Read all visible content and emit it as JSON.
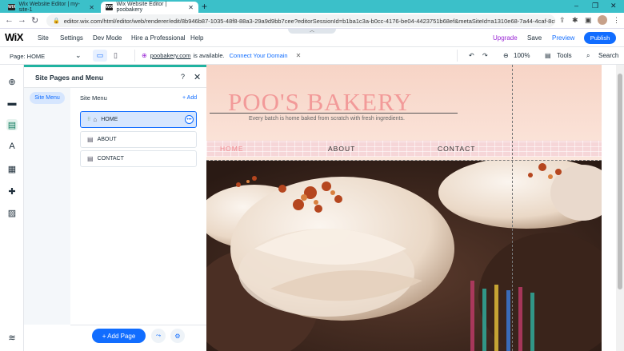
{
  "browser": {
    "tabs": [
      {
        "badge": "WIX",
        "title": "Wix Website Editor | my-site-1"
      },
      {
        "badge": "WIX",
        "title": "Wix Website Editor | poobakery"
      }
    ],
    "new_tab": "+",
    "url": "editor.wix.com/html/editor/web/renderer/edit/8b946b87-1035-48f8-88a3-29a9d9bb7cee?editorSessionId=b1ba1c3a-b0cc-4176-be04-4423751b68ef&metaSiteId=a1310e68-7a44-4caf-8c89...",
    "window_controls": [
      "–",
      "❐",
      "✕"
    ]
  },
  "wix": {
    "logo": "WiX",
    "menu": [
      "Site",
      "Settings",
      "Dev Mode",
      "Hire a Professional",
      "Help"
    ],
    "upgrade": "Upgrade",
    "save": "Save",
    "preview": "Preview",
    "publish": "Publish",
    "page_selector": "Page: HOME",
    "domain_name": "poobakery.com",
    "domain_status": "is available.",
    "connect_domain": "Connect Your Domain",
    "zoom": "100%",
    "tools": "Tools",
    "search": "Search"
  },
  "panel": {
    "title": "Site Pages and Menu",
    "help": "?",
    "side_tab": "Site Menu",
    "menu_heading": "Site Menu",
    "add": "+ Add",
    "pages": [
      "HOME",
      "ABOUT",
      "CONTACT"
    ],
    "add_page": "+ Add Page"
  },
  "site": {
    "title": "POO'S BAKERY",
    "tagline": "Every batch is home baked from scratch with fresh ingredients.",
    "nav": [
      "HOME",
      "ABOUT",
      "CONTACT"
    ]
  },
  "colors": {
    "accent": "#116dff",
    "teal": "#20b3a0",
    "title_pink": "#f29a99",
    "upgrade": "#9a27d5"
  }
}
